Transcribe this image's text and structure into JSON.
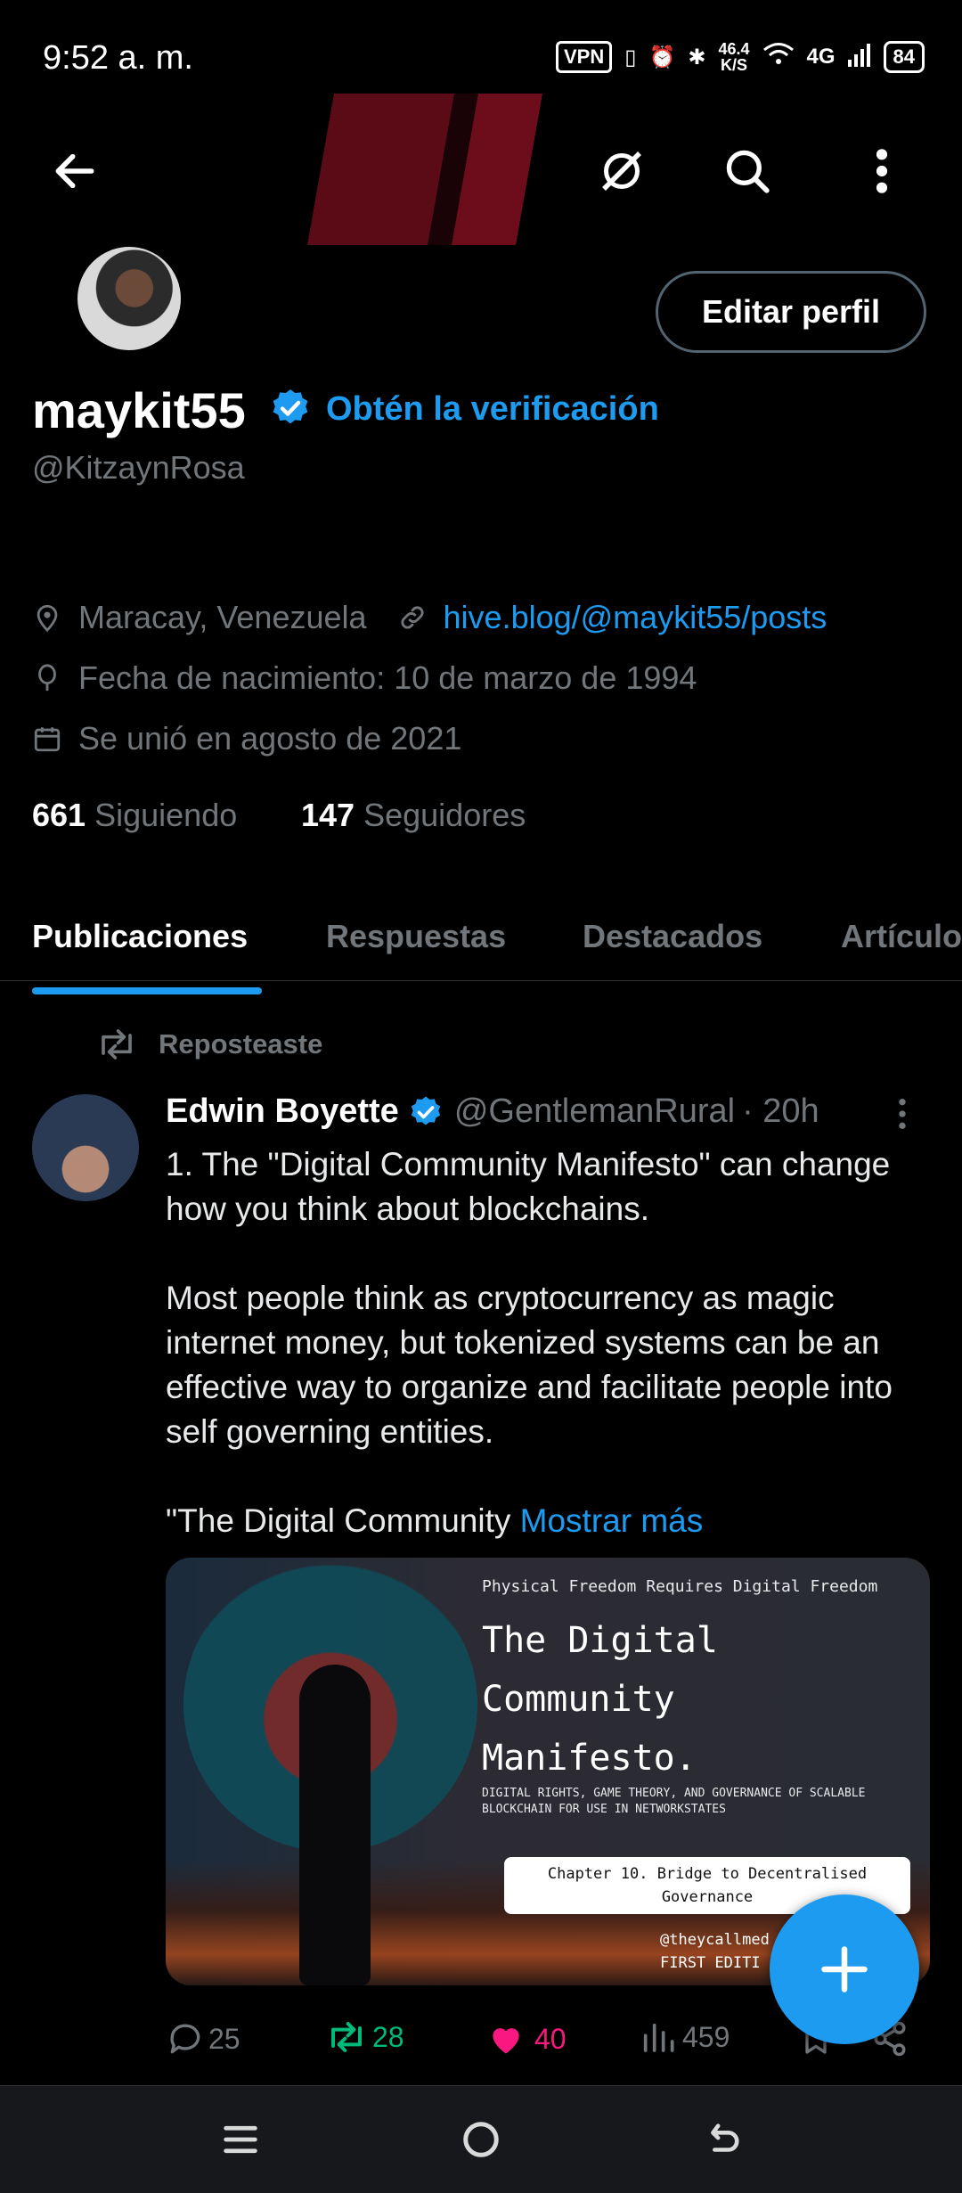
{
  "status_bar": {
    "time": "9:52 a. m.",
    "vpn": "VPN",
    "speed_value": "46.4",
    "speed_unit": "K/S",
    "network": "4G",
    "battery": "84"
  },
  "profile": {
    "display_name": "maykit55",
    "get_verified": "Obtén la verificación",
    "handle": "@KitzaynRosa",
    "edit_button": "Editar perfil",
    "location": "Maracay, Venezuela",
    "website": "hive.blog/@maykit55/posts",
    "birthday": "Fecha de nacimiento: 10 de marzo de 1994",
    "joined": "Se unió en agosto de 2021",
    "following_count": "661",
    "following_label": "Siguiendo",
    "followers_count": "147",
    "followers_label": "Seguidores"
  },
  "tabs": [
    "Publicaciones",
    "Respuestas",
    "Destacados",
    "Artículos"
  ],
  "post": {
    "repost_label": "Reposteaste",
    "author_name": "Edwin Boyette",
    "author_handle": "@GentlemanRural",
    "time": "· 20h",
    "text": "1. The \"Digital Community Manifesto\" can change how you think about blockchains.\n\nMost people think as cryptocurrency as magic internet money, but tokenized systems can be an effective way to organize and facilitate people into self governing entities.\n\n\"The Digital Community ",
    "show_more": "Mostrar más",
    "media": {
      "subtitle": "Physical Freedom Requires Digital Freedom",
      "title": "The Digital\nCommunity\nManifesto.",
      "description": "DIGITAL RIGHTS, GAME THEORY, AND GOVERNANCE OF SCALABLE BLOCKCHAIN FOR USE IN NETWORKSTATES",
      "chapter": "Chapter 10. Bridge to Decentralised Governance",
      "handle": "@theycallmed\nFIRST EDITI"
    },
    "replies": "25",
    "reposts": "28",
    "likes": "40",
    "views": "459"
  },
  "colors": {
    "accent": "#1d9bf0",
    "repost_green": "#00ba7c",
    "like_pink": "#f91880",
    "secondary_text": "#71767b"
  }
}
